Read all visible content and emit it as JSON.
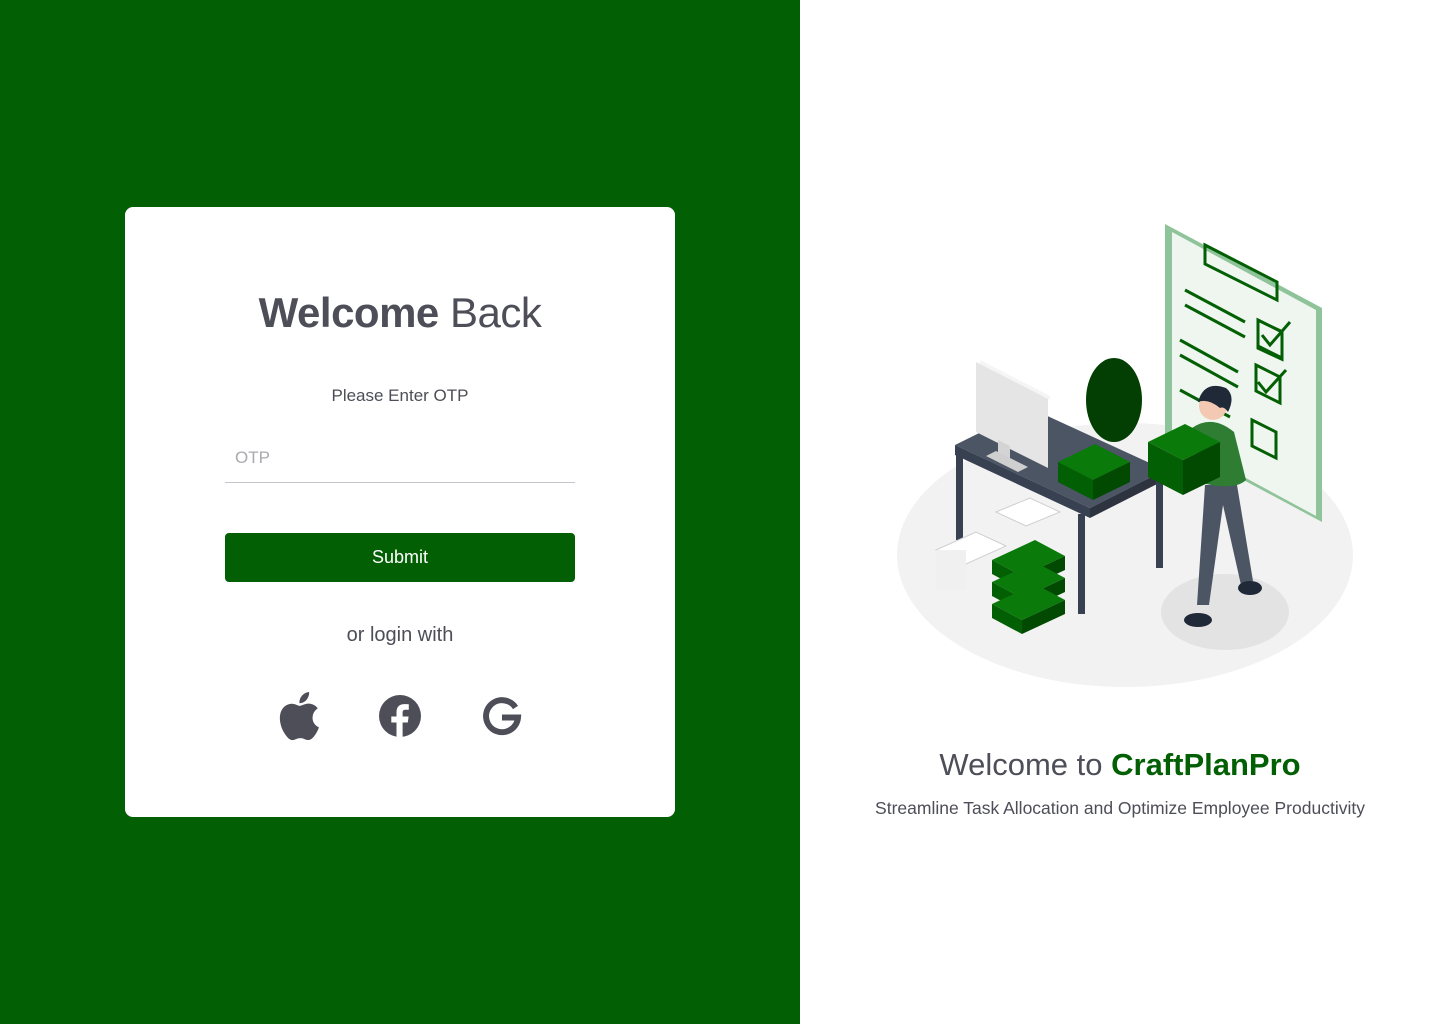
{
  "login": {
    "title_bold": "Welcome",
    "title_light": "Back",
    "prompt": "Please Enter OTP",
    "otp_placeholder": "OTP",
    "otp_value": "",
    "submit_label": "Submit",
    "alt_login_label": "or login with",
    "social_providers": [
      "apple-icon",
      "facebook-icon",
      "google-icon"
    ]
  },
  "hero": {
    "welcome_prefix": "Welcome to",
    "brand": "CraftPlanPro",
    "tagline": "Streamline Task Allocation and Optimize Employee Productivity",
    "illustration": "woman-carrying-folders-desk-checklist-illustration"
  },
  "colors": {
    "brand_green": "#035f03",
    "text_dark": "#4d4e57",
    "placeholder": "#a9aab0"
  }
}
